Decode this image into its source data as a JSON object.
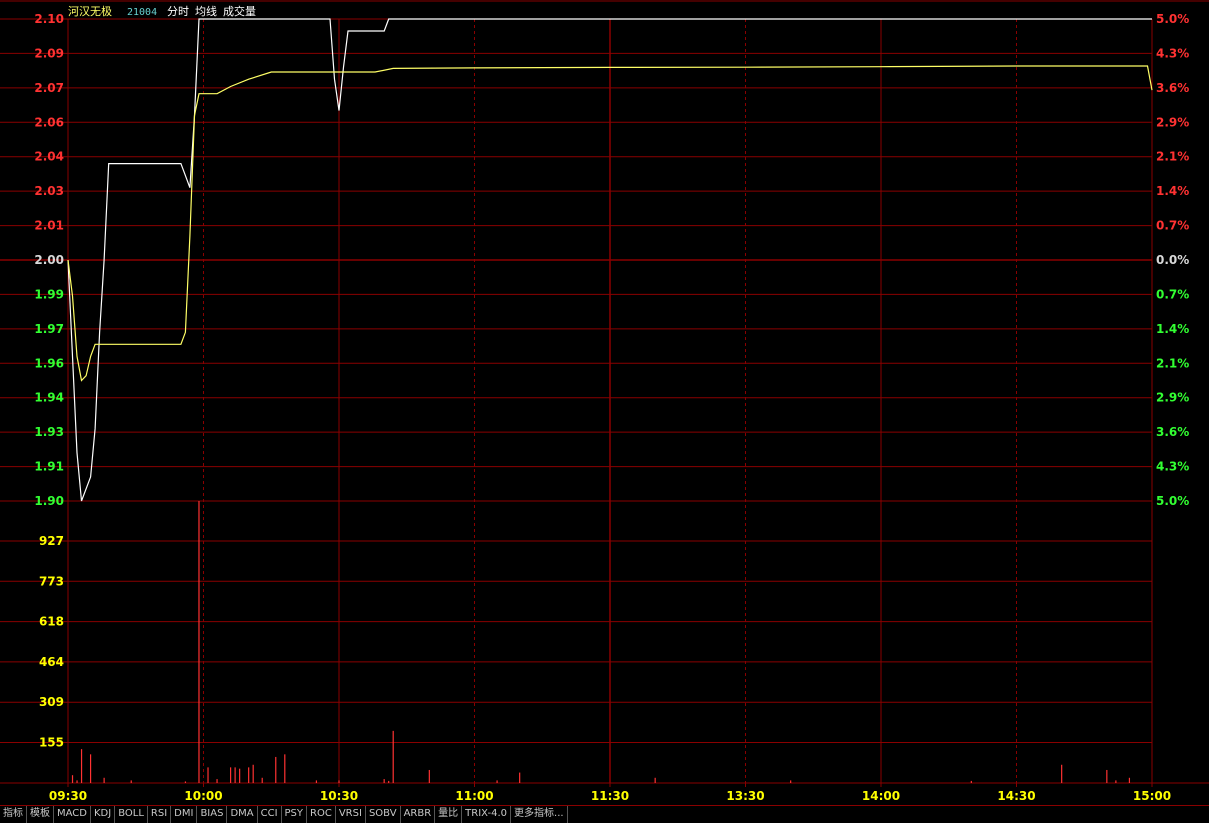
{
  "header": {
    "stock_name": "河汉无极",
    "stock_code": "21004",
    "labels": [
      "分时",
      "均线",
      "成交量"
    ]
  },
  "colors": {
    "up": "#ff3232",
    "down": "#32ff32",
    "neutral": "#d8d8d8",
    "grid": "#8a0000",
    "price_line": "#ffffff",
    "avg_line": "#ffff66",
    "volume_bar": "#ff3232",
    "volume_axis": "#ffff00",
    "time_axis": "#ffff00",
    "name_color": "#ffff66",
    "code_color": "#66d0d0"
  },
  "chart_data": {
    "type": "line",
    "title": "",
    "x_ticks": [
      "09:30",
      "10:00",
      "10:30",
      "11:00",
      "11:30",
      "13:30",
      "14:00",
      "14:30",
      "15:00"
    ],
    "price_axis": {
      "ylim": [
        1.9,
        2.1
      ],
      "base": 2.0,
      "ticks": [
        "2.10",
        "2.09",
        "2.07",
        "2.06",
        "2.04",
        "2.03",
        "2.01",
        "2.00",
        "1.99",
        "1.97",
        "1.96",
        "1.94",
        "1.93",
        "1.91",
        "1.90"
      ],
      "pct_ticks": [
        "5.0%",
        "4.3%",
        "3.6%",
        "2.9%",
        "2.1%",
        "1.4%",
        "0.7%",
        "0.0%",
        "0.7%",
        "1.4%",
        "2.1%",
        "2.9%",
        "3.6%",
        "4.3%",
        "5.0%"
      ]
    },
    "volume_axis": {
      "ylim": [
        0,
        1082
      ],
      "ticks": [
        "927",
        "773",
        "618",
        "464",
        "309",
        "155"
      ]
    },
    "series": [
      {
        "name": "分时",
        "points": [
          [
            0,
            2.0
          ],
          [
            1,
            1.96
          ],
          [
            2,
            1.92
          ],
          [
            3,
            1.9
          ],
          [
            5,
            1.91
          ],
          [
            6,
            1.93
          ],
          [
            7,
            1.97
          ],
          [
            8,
            2.0
          ],
          [
            9,
            2.04
          ],
          [
            10,
            2.04
          ],
          [
            15,
            2.04
          ],
          [
            20,
            2.04
          ],
          [
            25,
            2.04
          ],
          [
            26,
            2.035
          ],
          [
            27,
            2.03
          ],
          [
            28,
            2.06
          ],
          [
            29,
            2.1
          ],
          [
            30,
            2.1
          ],
          [
            40,
            2.1
          ],
          [
            50,
            2.1
          ],
          [
            58,
            2.1
          ],
          [
            59,
            2.075
          ],
          [
            60,
            2.062
          ],
          [
            61,
            2.08
          ],
          [
            62,
            2.095
          ],
          [
            63,
            2.095
          ],
          [
            70,
            2.095
          ],
          [
            71,
            2.1
          ],
          [
            72,
            2.1
          ],
          [
            100,
            2.1
          ],
          [
            150,
            2.1
          ],
          [
            200,
            2.1
          ],
          [
            239,
            2.1
          ],
          [
            240,
            2.1
          ]
        ]
      },
      {
        "name": "均线",
        "points": [
          [
            0,
            2.0
          ],
          [
            1,
            1.985
          ],
          [
            2,
            1.96
          ],
          [
            3,
            1.95
          ],
          [
            4,
            1.952
          ],
          [
            5,
            1.96
          ],
          [
            6,
            1.965
          ],
          [
            7,
            1.965
          ],
          [
            10,
            1.965
          ],
          [
            15,
            1.965
          ],
          [
            20,
            1.965
          ],
          [
            25,
            1.965
          ],
          [
            26,
            1.97
          ],
          [
            27,
            2.01
          ],
          [
            28,
            2.06
          ],
          [
            29,
            2.069
          ],
          [
            30,
            2.069
          ],
          [
            33,
            2.069
          ],
          [
            36,
            2.072
          ],
          [
            40,
            2.075
          ],
          [
            45,
            2.078
          ],
          [
            48,
            2.078
          ],
          [
            55,
            2.078
          ],
          [
            63,
            2.078
          ],
          [
            68,
            2.078
          ],
          [
            72,
            2.0795
          ],
          [
            90,
            2.0797
          ],
          [
            120,
            2.0799
          ],
          [
            150,
            2.08
          ],
          [
            180,
            2.0802
          ],
          [
            210,
            2.0805
          ],
          [
            239,
            2.0805
          ],
          [
            240,
            2.0705
          ]
        ]
      }
    ],
    "volume": [
      [
        1,
        30
      ],
      [
        2,
        10
      ],
      [
        3,
        130
      ],
      [
        5,
        110
      ],
      [
        8,
        20
      ],
      [
        14,
        10
      ],
      [
        26,
        6
      ],
      [
        29,
        1082
      ],
      [
        31,
        60
      ],
      [
        33,
        15
      ],
      [
        36,
        60
      ],
      [
        37,
        60
      ],
      [
        38,
        55
      ],
      [
        40,
        60
      ],
      [
        41,
        70
      ],
      [
        43,
        20
      ],
      [
        46,
        100
      ],
      [
        48,
        110
      ],
      [
        55,
        10
      ],
      [
        60,
        10
      ],
      [
        70,
        15
      ],
      [
        71,
        8
      ],
      [
        72,
        200
      ],
      [
        80,
        50
      ],
      [
        95,
        10
      ],
      [
        100,
        40
      ],
      [
        130,
        20
      ],
      [
        160,
        10
      ],
      [
        200,
        8
      ],
      [
        220,
        70
      ],
      [
        230,
        50
      ],
      [
        232,
        10
      ],
      [
        235,
        20
      ]
    ]
  },
  "toolbar": {
    "items": [
      "指标",
      "模板",
      "MACD",
      "KDJ",
      "BOLL",
      "RSI",
      "DMI",
      "BIAS",
      "DMA",
      "CCI",
      "PSY",
      "ROC",
      "VRSI",
      "SOBV",
      "ARBR",
      "量比",
      "TRIX-4.0",
      "更多指标..."
    ]
  }
}
